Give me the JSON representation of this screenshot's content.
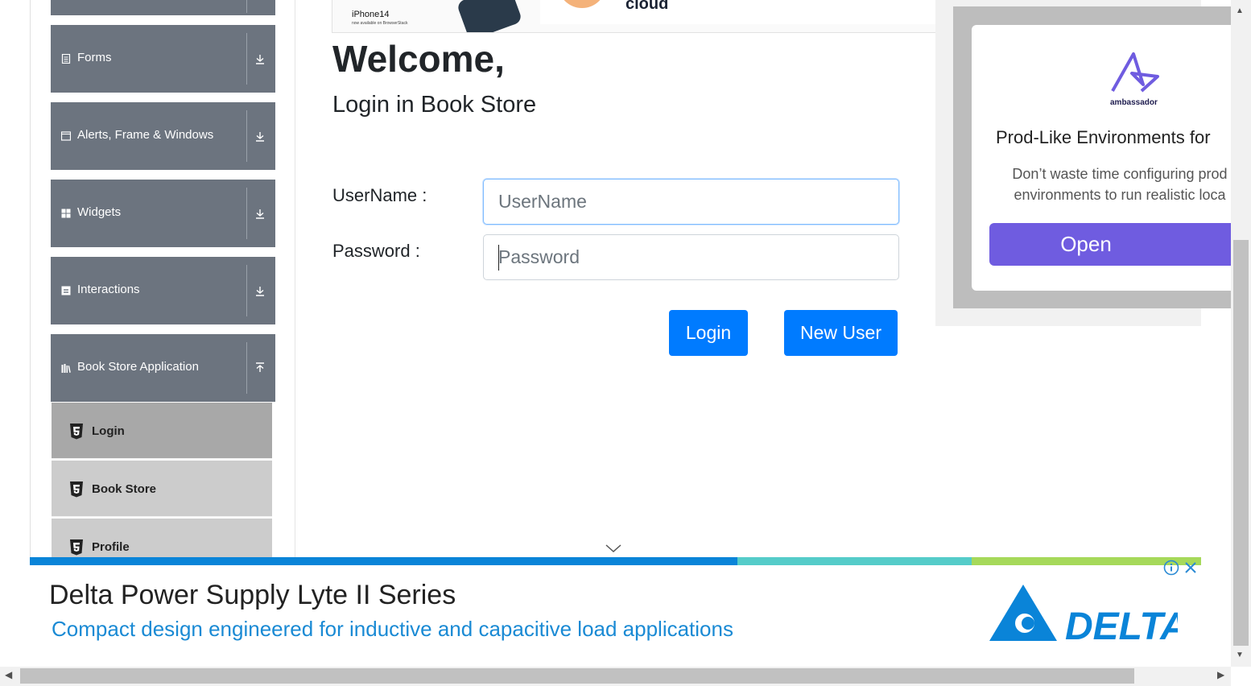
{
  "sidebar": {
    "groups": [
      {
        "label": "Forms",
        "icon": "forms-icon"
      },
      {
        "label": "Alerts, Frame & Windows",
        "icon": "window-icon"
      },
      {
        "label": "Widgets",
        "icon": "widgets-icon"
      },
      {
        "label": "Interactions",
        "icon": "interactions-icon"
      },
      {
        "label": "Book Store Application",
        "icon": "books-icon"
      }
    ],
    "items": [
      {
        "label": "Login",
        "active": true
      },
      {
        "label": "Book Store",
        "active": false
      },
      {
        "label": "Profile",
        "active": false
      }
    ]
  },
  "top_ad": {
    "product": "iPhone14",
    "product_sub": "now available on BrowserStack",
    "word": "cloud"
  },
  "main": {
    "welcome": "Welcome,",
    "subtitle": "Login in Book Store",
    "username_label": "UserName :",
    "username_placeholder": "UserName",
    "password_label": "Password :",
    "password_placeholder": "Password",
    "login_button": "Login",
    "new_user_button": "New User"
  },
  "right_ad": {
    "brand": "ambassador",
    "title": "Prod-Like Environments for",
    "line1": "Don’t waste time configuring prod",
    "line2": "environments to run realistic loca",
    "button": "Open",
    "accent": "#6f5ce0"
  },
  "bottom_ad": {
    "headline": "Delta Power Supply Lyte II Series",
    "tagline": "Compact design engineered for inductive and capacitive load applications",
    "brand": "DELTA",
    "accent": "#1a8ad4"
  },
  "colors": {
    "sidebar_group": "#6c747f",
    "primary_button": "#007bff"
  }
}
